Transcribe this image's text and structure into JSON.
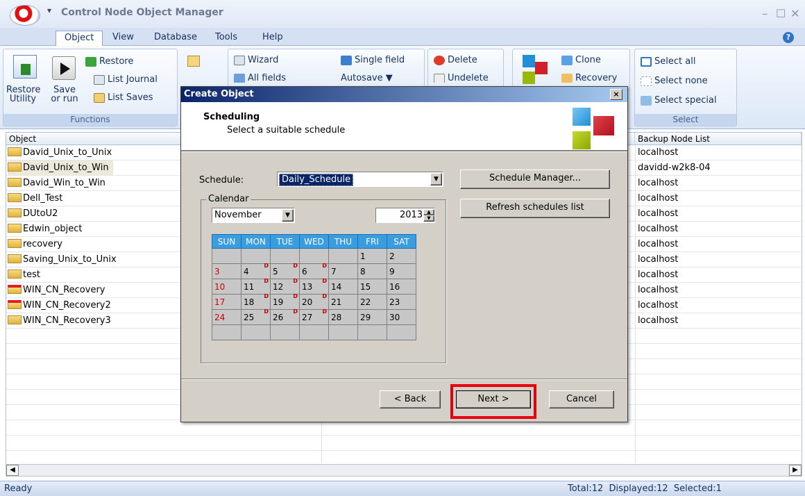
{
  "window": {
    "title": "Control Node Object Manager",
    "min": "–",
    "restore": "☐",
    "close": "✕"
  },
  "menu": {
    "tabs": [
      "Object",
      "View",
      "Database",
      "Tools",
      "Help"
    ],
    "help": "?"
  },
  "ribbon": {
    "restore_utility_l1": "Restore",
    "restore_utility_l2": "Utility",
    "save_or_run_l1": "Save",
    "save_or_run_l2": "or run",
    "restore": "Restore",
    "list_journal": "List Journal",
    "list_saves": "List Saves",
    "functions_label": "Functions",
    "wizard": "Wizard",
    "all_fields": "All fields",
    "single_field": "Single field",
    "autosave": "Autosave ▼",
    "delete": "Delete",
    "undelete": "Undelete",
    "clone": "Clone",
    "recovery": "Recovery",
    "select_all": "Select all",
    "select_none": "Select none",
    "select_special": "Select special",
    "select_label": "Select"
  },
  "list": {
    "headers": {
      "object": "Object",
      "backup_node_list": "Backup Node List"
    },
    "rows": [
      {
        "name": "David_Unix_to_Unix",
        "node": "localhost",
        "red": false
      },
      {
        "name": "David_Unix_to_Win",
        "node": "davidd-w2k8-04",
        "red": false,
        "selected": true
      },
      {
        "name": "David_Win_to_Win",
        "node": "localhost",
        "red": false
      },
      {
        "name": "Dell_Test",
        "node": "localhost",
        "red": false
      },
      {
        "name": "DUtoU2",
        "node": "localhost",
        "red": false
      },
      {
        "name": "Edwin_object",
        "node": "localhost",
        "red": false
      },
      {
        "name": "recovery",
        "node": "localhost",
        "red": false
      },
      {
        "name": "Saving_Unix_to_Unix",
        "node": "localhost",
        "red": false
      },
      {
        "name": "test",
        "node": "localhost",
        "red": false
      },
      {
        "name": "WIN_CN_Recovery",
        "node": "localhost",
        "red": true
      },
      {
        "name": "WIN_CN_Recovery2",
        "node": "localhost",
        "red": true
      },
      {
        "name": "WIN_CN_Recovery3",
        "node": "localhost",
        "red": false
      }
    ]
  },
  "status": {
    "left": "Ready",
    "right": "Total:12  Displayed:12  Selected:1"
  },
  "dialog": {
    "title": "Create Object",
    "close": "×",
    "heading": "Scheduling",
    "subheading": "Select a suitable schedule",
    "schedule_label": "Schedule:",
    "schedule_value": "Daily_Schedule",
    "calendar_label": "Calendar",
    "month": "November",
    "year": "2013",
    "schedule_manager": "Schedule Manager...",
    "refresh": "Refresh schedules list",
    "back": "< Back",
    "next": "Next >",
    "cancel": "Cancel",
    "weekdays": [
      "SUN",
      "MON",
      "TUE",
      "WED",
      "THU",
      "FRI",
      "SAT"
    ],
    "weeks": [
      [
        {
          "d": ""
        },
        {
          "d": ""
        },
        {
          "d": ""
        },
        {
          "d": ""
        },
        {
          "d": ""
        },
        {
          "d": "1"
        },
        {
          "d": "2"
        }
      ],
      [
        {
          "d": "3"
        },
        {
          "d": "4",
          "m": "D"
        },
        {
          "d": "5",
          "m": "D"
        },
        {
          "d": "6",
          "m": "D"
        },
        {
          "d": "7"
        },
        {
          "d": "8"
        },
        {
          "d": "9"
        }
      ],
      [
        {
          "d": "10"
        },
        {
          "d": "11",
          "m": "D"
        },
        {
          "d": "12",
          "m": "D"
        },
        {
          "d": "13",
          "m": "D"
        },
        {
          "d": "14"
        },
        {
          "d": "15"
        },
        {
          "d": "16"
        }
      ],
      [
        {
          "d": "17"
        },
        {
          "d": "18",
          "m": "D"
        },
        {
          "d": "19",
          "m": "D"
        },
        {
          "d": "20",
          "m": "D"
        },
        {
          "d": "21"
        },
        {
          "d": "22"
        },
        {
          "d": "23"
        }
      ],
      [
        {
          "d": "24"
        },
        {
          "d": "25",
          "m": "D"
        },
        {
          "d": "26",
          "m": "D"
        },
        {
          "d": "27",
          "m": "D"
        },
        {
          "d": "28"
        },
        {
          "d": "29"
        },
        {
          "d": "30"
        }
      ],
      [
        {
          "d": ""
        },
        {
          "d": ""
        },
        {
          "d": ""
        },
        {
          "d": ""
        },
        {
          "d": ""
        },
        {
          "d": ""
        },
        {
          "d": ""
        }
      ]
    ]
  },
  "colors": {
    "highlight": "#e8000e",
    "calendar_header": "#3a9ddf",
    "selection": "#0a246a"
  }
}
